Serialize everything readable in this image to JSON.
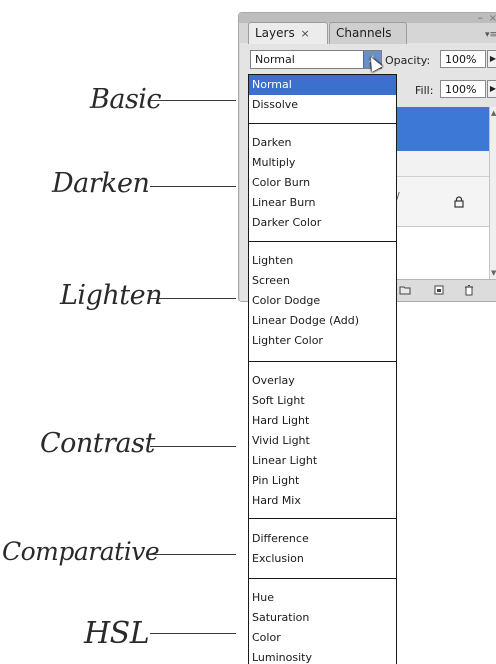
{
  "panel": {
    "tabs": [
      {
        "label": "Layers",
        "close": "×"
      },
      {
        "label": "Channels"
      }
    ],
    "minimize_glyph": "–",
    "collapse_glyph": "×",
    "blend_mode_value": "Normal",
    "opacity_label": "Opacity:",
    "opacity_value": "100%",
    "fill_label": "Fill:",
    "fill_value": "100%"
  },
  "blend_modes": {
    "groups": [
      {
        "items": [
          "Normal",
          "Dissolve"
        ]
      },
      {
        "items": [
          "Darken",
          "Multiply",
          "Color Burn",
          "Linear Burn",
          "Darker Color"
        ]
      },
      {
        "items": [
          "Lighten",
          "Screen",
          "Color Dodge",
          "Linear Dodge (Add)",
          "Lighter Color"
        ]
      },
      {
        "items": [
          "Overlay",
          "Soft Light",
          "Hard Light",
          "Vivid Light",
          "Linear Light",
          "Pin Light",
          "Hard Mix"
        ]
      },
      {
        "items": [
          "Difference",
          "Exclusion"
        ]
      },
      {
        "items": [
          "Hue",
          "Saturation",
          "Color",
          "Luminosity"
        ]
      }
    ],
    "selected": "Normal"
  },
  "annotations": {
    "basic": "Basic",
    "darken": "Darken",
    "lighten": "Lighten",
    "contrast": "Contrast",
    "comparative": "Comparative",
    "hsl": "HSL"
  },
  "colors": {
    "selection": "#3c6fce",
    "layer_selected": "#3d78d6"
  }
}
